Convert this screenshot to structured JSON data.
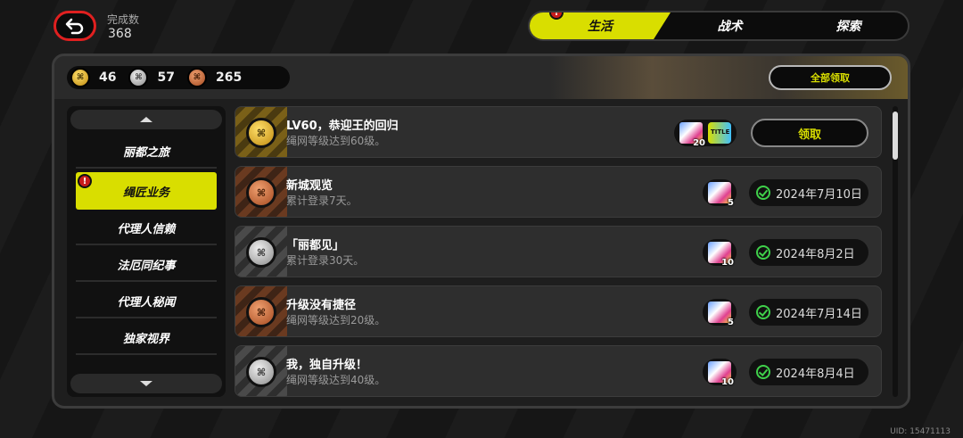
{
  "header": {
    "completion_label": "完成数",
    "completion_value": "368",
    "tabs": [
      {
        "label": "生活",
        "active": true,
        "alert": "!"
      },
      {
        "label": "战术",
        "active": false
      },
      {
        "label": "探索",
        "active": false
      }
    ]
  },
  "currency": [
    {
      "icon": "gold-medal-icon",
      "value": "46"
    },
    {
      "icon": "silver-medal-icon",
      "value": "57"
    },
    {
      "icon": "bronze-medal-icon",
      "value": "265"
    }
  ],
  "claim_all_label": "全部领取",
  "sidebar": {
    "items": [
      {
        "label": "丽都之旅",
        "active": false
      },
      {
        "label": "绳匠业务",
        "active": true,
        "alert": "!"
      },
      {
        "label": "代理人信赖",
        "active": false
      },
      {
        "label": "法厄同纪事",
        "active": false
      },
      {
        "label": "代理人秘闻",
        "active": false
      },
      {
        "label": "独家视界",
        "active": false
      }
    ]
  },
  "achievements": [
    {
      "medal": "gold",
      "title": "LV60，恭迎王的回归",
      "desc": "绳网等级达到60级。",
      "rewards": [
        {
          "count": "20",
          "type": "card"
        },
        {
          "count": "",
          "type": "title",
          "text": "TITLE"
        }
      ],
      "claim_label": "领取",
      "date": ""
    },
    {
      "medal": "bronze",
      "title": "新城观览",
      "desc": "累计登录7天。",
      "rewards": [
        {
          "count": "5",
          "type": "card"
        }
      ],
      "claim_label": "",
      "date": "2024年7月10日"
    },
    {
      "medal": "silver",
      "title": "「丽都见」",
      "desc": "累计登录30天。",
      "rewards": [
        {
          "count": "10",
          "type": "card"
        }
      ],
      "claim_label": "",
      "date": "2024年8月2日"
    },
    {
      "medal": "bronze",
      "title": "升级没有捷径",
      "desc": "绳网等级达到20级。",
      "rewards": [
        {
          "count": "5",
          "type": "card"
        }
      ],
      "claim_label": "",
      "date": "2024年7月14日"
    },
    {
      "medal": "silver",
      "title": "我，独自升级！",
      "desc": "绳网等级达到40级。",
      "rewards": [
        {
          "count": "10",
          "type": "card"
        }
      ],
      "claim_label": "",
      "date": "2024年8月4日"
    }
  ],
  "uid": "UID: 15471113",
  "colors": {
    "accent": "#d9de00",
    "alert": "#c81c1c",
    "check": "#3fd04a"
  }
}
